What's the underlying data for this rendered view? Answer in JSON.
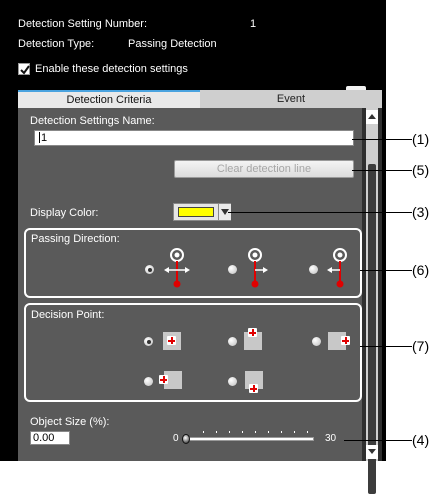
{
  "header": {
    "setting_number_label": "Detection Setting Number:",
    "setting_number_value": "1",
    "type_label": "Detection Type:",
    "type_value": "Passing Detection",
    "enable_label": "Enable these detection settings",
    "enable_checked": true
  },
  "tabs": [
    {
      "label": "Detection Criteria",
      "active": true
    },
    {
      "label": "Event",
      "active": false
    }
  ],
  "form": {
    "name_label": "Detection Settings Name:",
    "name_value": "1",
    "clear_button": "Clear detection line",
    "display_color_label": "Display Color:",
    "display_color": "#ffff00",
    "passing_direction_label": "Passing Direction:",
    "passing_direction_selected": 0,
    "decision_point_label": "Decision Point:",
    "decision_point_selected": 0,
    "object_size_label": "Object Size (%):",
    "object_size_value": "0.00",
    "slider_min": "0",
    "slider_max": "30"
  },
  "callouts": {
    "c1": "(1)",
    "c5": "(5)",
    "c3": "(3)",
    "c6": "(6)",
    "c7": "(7)",
    "c4": "(4)"
  },
  "icons": {
    "passing_options": [
      "bidirectional-arrow-icon",
      "right-arrow-icon",
      "left-arrow-icon"
    ],
    "decision_options": [
      "center-point-icon",
      "top-center-point-icon",
      "right-center-point-icon",
      "left-center-point-icon",
      "bottom-center-point-icon"
    ]
  },
  "colors": {
    "panel_bg": "#000000",
    "content_bg": "#5a5a5a",
    "tab_accent": "#4aa3df",
    "marker_red": "#e00000"
  }
}
